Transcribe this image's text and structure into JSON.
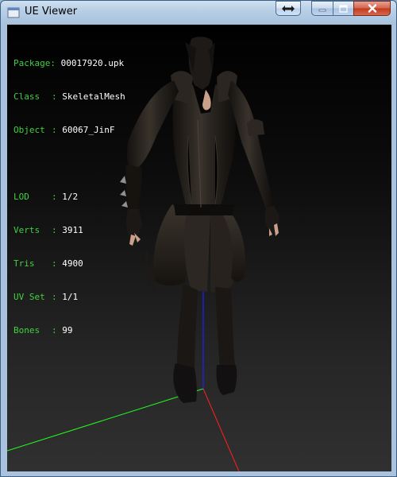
{
  "window": {
    "title": "UE Viewer"
  },
  "titlebar_buttons": {
    "layout_icon": "double-arrow-icon",
    "minimize_icon": "minimize-icon",
    "maximize_icon": "maximize-icon",
    "close_icon": "close-icon"
  },
  "info": {
    "package_key": "Package:",
    "package_val": "00017920.upk",
    "class_key": "Class",
    "class_val": "SkeletalMesh",
    "object_key": "Object",
    "object_val": "60067_JinF",
    "lod_key": "LOD",
    "lod_val": "1/2",
    "verts_key": "Verts",
    "verts_val": "3911",
    "tris_key": "Tris",
    "tris_val": "4900",
    "uvset_key": "UV Set",
    "uvset_val": "1/1",
    "bones_key": "Bones",
    "bones_val": "99",
    "separator": ":"
  },
  "colors": {
    "label": "#3fd23f",
    "value": "#ffffff",
    "axis_x": "#ff2020",
    "axis_y": "#20ff20",
    "axis_z": "#2020ff"
  }
}
